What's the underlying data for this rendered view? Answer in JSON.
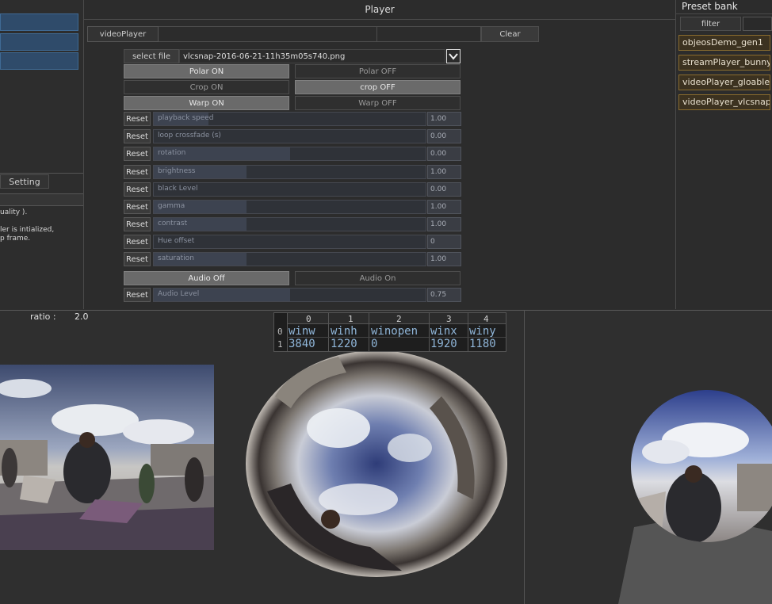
{
  "left_panel": {
    "tab_label": "Setting",
    "text_lines": [
      "uality ).",
      "",
      "ler is intialized,",
      "p frame."
    ]
  },
  "player": {
    "title": "Player",
    "tab_label": "videoPlayer",
    "clear_label": "Clear",
    "select_file_label": "select file",
    "file_name": "vlcsnap-2016-06-21-11h35m05s740.png",
    "toggles": [
      {
        "on_label": "Polar ON",
        "off_label": "Polar OFF"
      },
      {
        "on_label": "Crop ON",
        "off_label": "crop OFF"
      },
      {
        "on_label": "Warp ON",
        "off_label": "Warp OFF"
      }
    ],
    "reset_label": "Reset",
    "sliders": [
      {
        "label": "playback speed",
        "value": "1.00",
        "fill": 0.2
      },
      {
        "label": "loop crossfade (s)",
        "value": "0.00",
        "fill": 0.0
      },
      {
        "label": "rotation",
        "value": "0.00",
        "fill": 0.5
      },
      {
        "label": "brightness",
        "value": "1.00",
        "fill": 0.34
      },
      {
        "label": "black Level",
        "value": "0.00",
        "fill": 0.0
      },
      {
        "label": "gamma",
        "value": "1.00",
        "fill": 0.34
      },
      {
        "label": "contrast",
        "value": "1.00",
        "fill": 0.34
      },
      {
        "label": "Hue offset",
        "value": "0",
        "fill": 0.0
      },
      {
        "label": "saturation",
        "value": "1.00",
        "fill": 0.34
      }
    ],
    "audio_off_label": "Audio Off",
    "audio_on_label": "Audio On",
    "audio_level": {
      "label": "Audio Level",
      "value": "0.75",
      "fill": 0.5
    }
  },
  "preset_bank": {
    "title": "Preset bank",
    "filter_label": "filter",
    "items": [
      "objeosDemo_gen1",
      "streamPlayer_bunny",
      "videoPlayer_gloablee",
      "videoPlayer_vlcsnap"
    ]
  },
  "viewport": {
    "ratio_label": "ratio :",
    "ratio_value": "2.0",
    "table": {
      "col_headers": [
        "0",
        "1",
        "2",
        "3",
        "4"
      ],
      "row_indices": [
        "0",
        "1"
      ],
      "rows": [
        [
          "winw",
          "winh",
          "winopen",
          "winx",
          "winy"
        ],
        [
          "3840",
          "1220",
          "0",
          "1920",
          "1180"
        ]
      ]
    }
  },
  "colors": {
    "accent_preset_border": "#8a6c2e",
    "table_text": "#8fb5d8"
  }
}
